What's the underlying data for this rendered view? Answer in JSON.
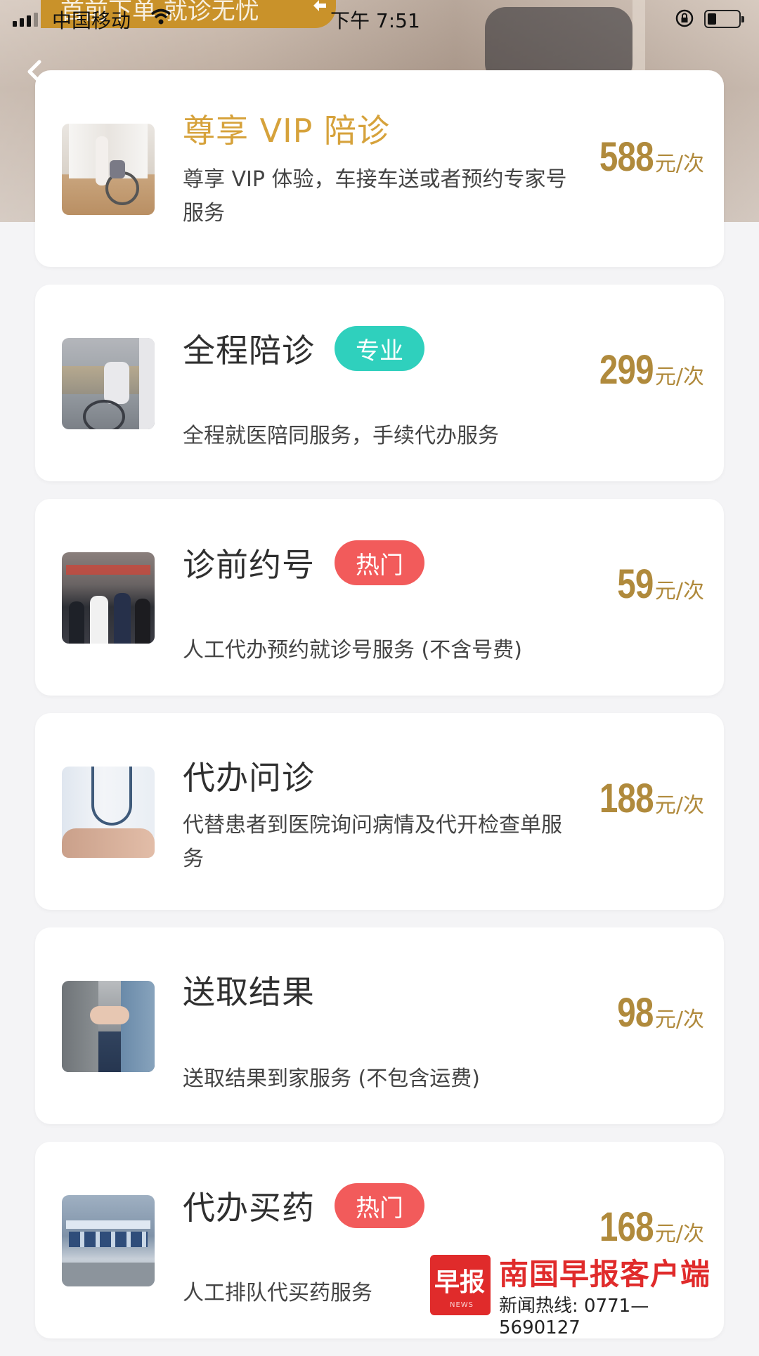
{
  "status_bar": {
    "carrier": "中国移动",
    "time": "下午 7:51"
  },
  "banner": {
    "text": "首前下单 就诊无忧"
  },
  "services": [
    {
      "title": "尊享 VIP 陪诊",
      "tag": "",
      "tag_color": "",
      "desc": "尊享 VIP 体验，车接车送或者预约专家号服务",
      "price": "588",
      "unit": "元/次",
      "vip": true
    },
    {
      "title": "全程陪诊",
      "tag": "专业",
      "tag_color": "green",
      "desc": "全程就医陪同服务，手续代办服务",
      "price": "299",
      "unit": "元/次",
      "vip": false
    },
    {
      "title": "诊前约号",
      "tag": "热门",
      "tag_color": "red",
      "desc": "人工代办预约就诊号服务 (不含号费)",
      "price": "59",
      "unit": "元/次",
      "vip": false
    },
    {
      "title": "代办问诊",
      "tag": "",
      "tag_color": "",
      "desc": "代替患者到医院询问病情及代开检查单服务",
      "price": "188",
      "unit": "元/次",
      "vip": false
    },
    {
      "title": "送取结果",
      "tag": "",
      "tag_color": "",
      "desc": "送取结果到家服务 (不包含运费)",
      "price": "98",
      "unit": "元/次",
      "vip": false
    },
    {
      "title": "代办买药",
      "tag": "热门",
      "tag_color": "red",
      "desc": "人工排队代买药服务",
      "price": "168",
      "unit": "元/次",
      "vip": false
    }
  ],
  "watermark": {
    "logo_text": "早报",
    "logo_sub": "NEWS",
    "name": "南国早报客户端",
    "hotline": "新闻热线: 0771— 5690127"
  },
  "colors": {
    "price": "#b08a3c",
    "vip_title": "#d6a23b",
    "tag_green": "#2fd0bd",
    "tag_red": "#f25b5b",
    "watermark_red": "#e02b2b"
  }
}
